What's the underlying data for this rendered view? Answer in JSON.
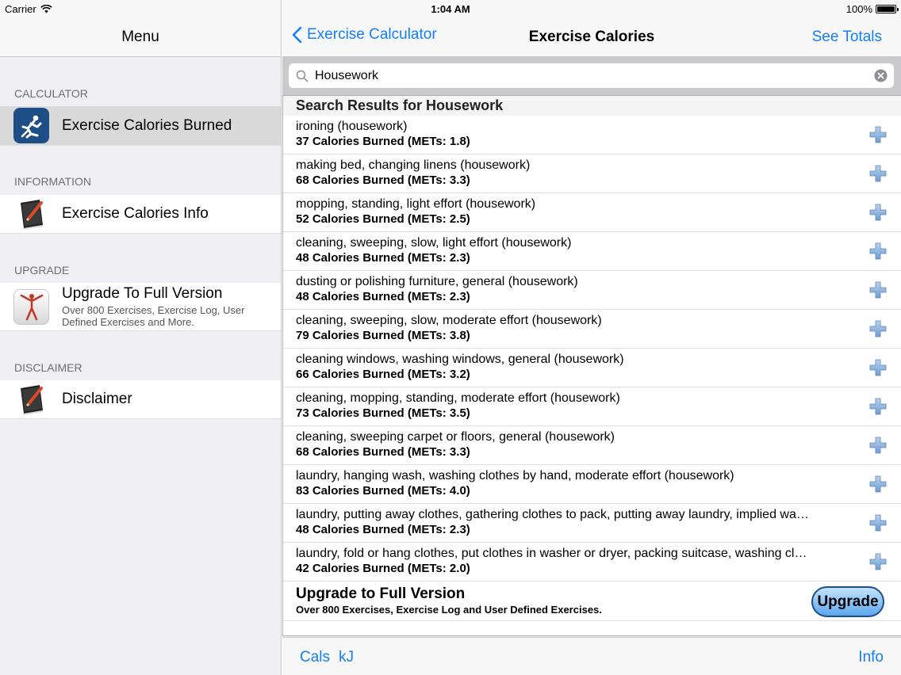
{
  "status_bar": {
    "carrier": "Carrier",
    "time": "1:04 AM",
    "battery": "100%"
  },
  "sidebar": {
    "title": "Menu",
    "sections": [
      {
        "header": "CALCULATOR",
        "items": [
          {
            "label": "Exercise Calories Burned",
            "icon": "running-man-icon",
            "selected": true
          }
        ]
      },
      {
        "header": "INFORMATION",
        "items": [
          {
            "label": "Exercise Calories Info",
            "icon": "book-pen-icon"
          }
        ]
      },
      {
        "header": "UPGRADE",
        "items": [
          {
            "label": "Upgrade To Full Version",
            "subtitle": "Over 800 Exercises, Exercise Log, User Defined Exercises and More.",
            "icon": "stretching-woman-icon"
          }
        ]
      },
      {
        "header": "DISCLAIMER",
        "items": [
          {
            "label": "Disclaimer",
            "icon": "book-pen-icon"
          }
        ]
      }
    ]
  },
  "main": {
    "nav": {
      "back_label": "Exercise Calculator",
      "title": "Exercise Calories",
      "right_label": "See Totals"
    },
    "search": {
      "value": "Housework",
      "placeholder": ""
    },
    "results_header": "Search Results for Housework",
    "results": [
      {
        "name": "ironing (housework)",
        "calories": "37 Calories Burned  (METs: 1.8)"
      },
      {
        "name": "making bed, changing linens (housework)",
        "calories": "68 Calories Burned  (METs: 3.3)"
      },
      {
        "name": "mopping, standing, light effort (housework)",
        "calories": "52 Calories Burned  (METs: 2.5)"
      },
      {
        "name": "cleaning, sweeping, slow, light effort (housework)",
        "calories": "48 Calories Burned  (METs: 2.3)"
      },
      {
        "name": "dusting or polishing furniture, general (housework)",
        "calories": "48 Calories Burned  (METs: 2.3)"
      },
      {
        "name": "cleaning, sweeping, slow, moderate effort (housework)",
        "calories": "79 Calories Burned  (METs: 3.8)"
      },
      {
        "name": "cleaning windows, washing windows, general (housework)",
        "calories": "66 Calories Burned  (METs: 3.2)"
      },
      {
        "name": "cleaning, mopping, standing, moderate effort (housework)",
        "calories": "73 Calories Burned  (METs: 3.5)"
      },
      {
        "name": "cleaning, sweeping carpet or floors, general (housework)",
        "calories": "68 Calories Burned  (METs: 3.3)"
      },
      {
        "name": "laundry, hanging wash, washing clothes by hand, moderate effort (housework)",
        "calories": "83 Calories Burned  (METs: 4.0)"
      },
      {
        "name": "laundry, putting away clothes, gathering clothes to pack, putting away laundry, implied wa…",
        "calories": "48 Calories Burned  (METs: 2.3)"
      },
      {
        "name": "laundry, fold or hang clothes, put clothes in washer or dryer, packing suitcase, washing cl…",
        "calories": "42 Calories Burned  (METs: 2.0)"
      }
    ],
    "upgrade": {
      "title": "Upgrade to Full Version",
      "subtitle": "Over 800 Exercises, Exercise Log and User Defined Exercises.",
      "button_label": "Upgrade"
    },
    "toolbar": {
      "cals": "Cals",
      "kj": "kJ",
      "info": "Info"
    }
  },
  "colors": {
    "accent": "#147efb",
    "sidebar_bg": "#efeff4",
    "selected_row": "#d9d9d9"
  }
}
